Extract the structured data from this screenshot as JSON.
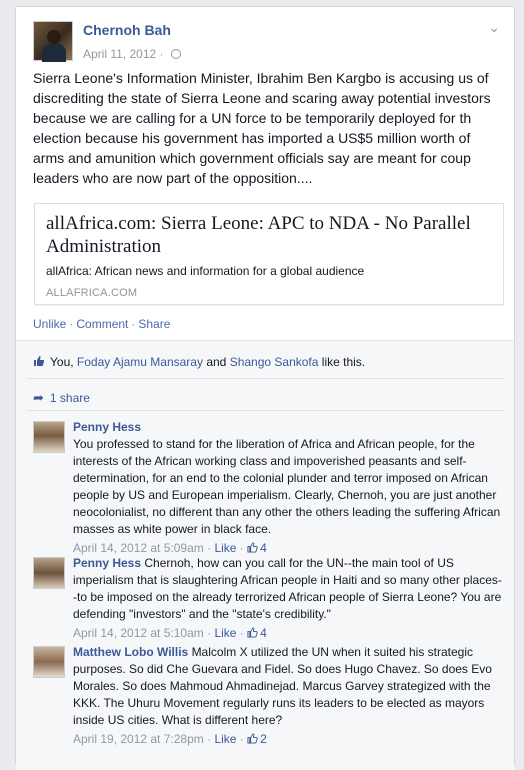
{
  "post": {
    "author": "Chernoh Bah",
    "date": "April 11, 2012",
    "separator": "·",
    "text": "Sierra Leone's Information Minister, Ibrahim Ben Kargbo is accusing us of discrediting the state of Sierra Leone and scaring away potential investors because we are calling for a UN force to be temporarily deployed for th election because his government has imported a US$5 million worth of arms and amunition which government officials say are meant for coup leaders who are now part of the opposition....",
    "link": {
      "title": "allAfrica.com: Sierra Leone: APC to NDA - No Parallel Administration",
      "description": "allAfrica: African news and information for a global audience",
      "domain": "ALLAFRICA.COM"
    },
    "actions": {
      "unlike": "Unlike",
      "comment": "Comment",
      "share": "Share",
      "sep": "·"
    }
  },
  "likes": {
    "prefix": "You, ",
    "person1": "Foday Ajamu Mansaray",
    "middle": " and ",
    "person2": "Shango Sankofa",
    "suffix": " like this."
  },
  "shares": {
    "label": "1 share"
  },
  "comments": [
    {
      "name": "Penny Hess",
      "text": "You professed to stand for the liberation of Africa and African people, for the interests of the African working class and impoverished peasants and self-determination, for an end to the colonial plunder and terror imposed on African people by US and European imperialism. Clearly, Chernoh, you are just another neocolonialist, no different than any other the others leading the suffering African masses as white power in black face.",
      "time": "April 14, 2012 at 5:09am",
      "like": "Like",
      "count": "4",
      "sep": " · "
    },
    {
      "name": "Penny Hess",
      "text": "Chernoh, how can you call for the UN--the main tool of US imperialism that is slaughtering African people in Haiti and so many other places--to be imposed on the already terrorized African people of Sierra Leone? You are defending \"investors\" and the \"state's credibility.\"",
      "time": "April 14, 2012 at 5:10am",
      "like": "Like",
      "count": "4",
      "sep": " · "
    },
    {
      "name": "Matthew Lobo Willis",
      "text": "Malcolm X utilized the UN when it suited his strategic purposes. So did Che Guevara and Fidel. So does Hugo Chavez. So does Evo Morales. So does Mahmoud Ahmadinejad. Marcus Garvey strategized with the KKK. The Uhuru Movement regularly runs its leaders to be elected as mayors inside US cities. What is different here?",
      "time": "April 19, 2012 at 7:28pm",
      "like": "Like",
      "count": "2",
      "sep": " · "
    }
  ],
  "colors": {
    "link": "#3b5998",
    "meta": "#9197a3",
    "background": "#e9ebee"
  }
}
